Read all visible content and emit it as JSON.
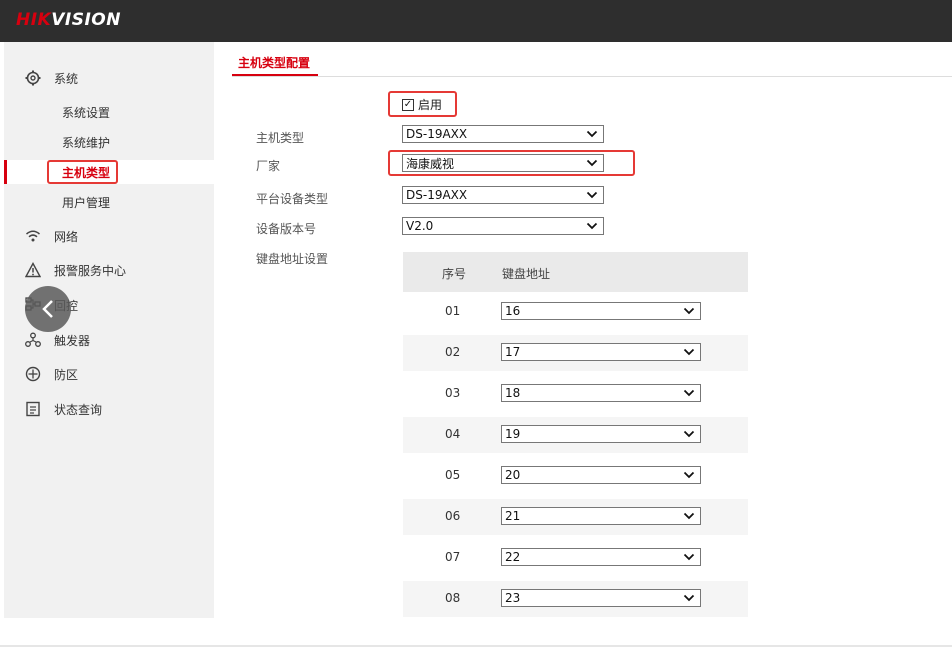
{
  "header": {
    "logo_part1": "HIK",
    "logo_part2": "VISION"
  },
  "sidebar": {
    "items": [
      {
        "label": "系统",
        "icon": "gear-icon"
      },
      {
        "label": "网络",
        "icon": "wifi-icon"
      },
      {
        "label": "报警服务中心",
        "icon": "warning-icon"
      },
      {
        "label": "回控",
        "icon": "network-icon"
      },
      {
        "label": "触发器",
        "icon": "trigger-icon"
      },
      {
        "label": "防区",
        "icon": "shield-icon"
      },
      {
        "label": "状态查询",
        "icon": "document-icon"
      }
    ],
    "sub_items": [
      {
        "label": "系统设置"
      },
      {
        "label": "系统维护"
      },
      {
        "label": "主机类型",
        "active": true
      },
      {
        "label": "用户管理"
      }
    ]
  },
  "main": {
    "tab": "主机类型配置",
    "enable_label": "启用",
    "enable_checked": true,
    "fields": [
      {
        "label": "主机类型",
        "value": "DS-19AXX"
      },
      {
        "label": "厂家",
        "value": "海康威视"
      },
      {
        "label": "平台设备类型",
        "value": "DS-19AXX"
      },
      {
        "label": "设备版本号",
        "value": "V2.0"
      }
    ],
    "keyboard_label": "键盘地址设置",
    "table": {
      "headers": [
        "序号",
        "键盘地址"
      ],
      "rows": [
        {
          "index": "01",
          "value": "16"
        },
        {
          "index": "02",
          "value": "17"
        },
        {
          "index": "03",
          "value": "18"
        },
        {
          "index": "04",
          "value": "19"
        },
        {
          "index": "05",
          "value": "20"
        },
        {
          "index": "06",
          "value": "21"
        },
        {
          "index": "07",
          "value": "22"
        },
        {
          "index": "08",
          "value": "23"
        }
      ]
    }
  },
  "colors": {
    "brand_red": "#d7000f",
    "highlight": "#e53935",
    "topbar": "#2e2e2e",
    "sidebar": "#f1f1f1"
  }
}
